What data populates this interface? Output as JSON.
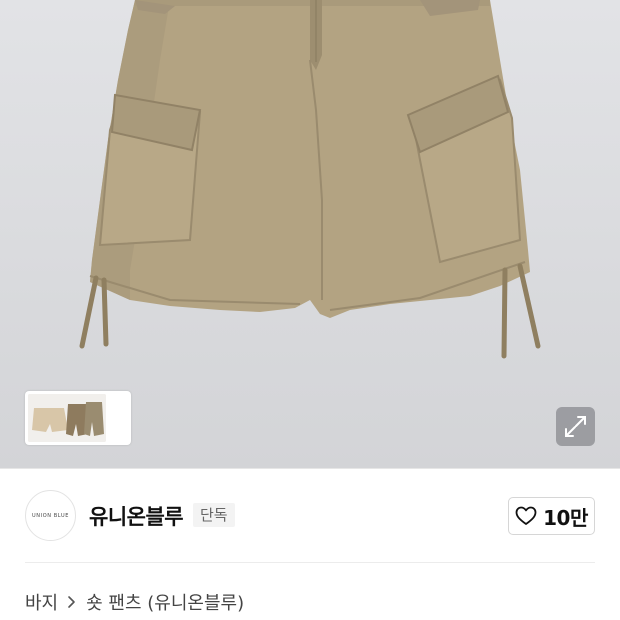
{
  "product": {
    "image_alt": "cargo-shorts-beige",
    "thumbnail_alt": "color-variants-thumbnail"
  },
  "brand": {
    "logo_text": "UNION BLUE",
    "name": "유니온블루",
    "badge": "단독"
  },
  "like": {
    "count": "10만",
    "icon": "heart-outline-icon"
  },
  "breadcrumb": {
    "items": [
      "바지",
      "숏 팬츠 (유니온블루)"
    ]
  },
  "colors": {
    "hero_bg": "#dcdde0",
    "shorts": "#b2a281",
    "text_primary": "#111111",
    "badge_bg": "#f3f3f3"
  }
}
